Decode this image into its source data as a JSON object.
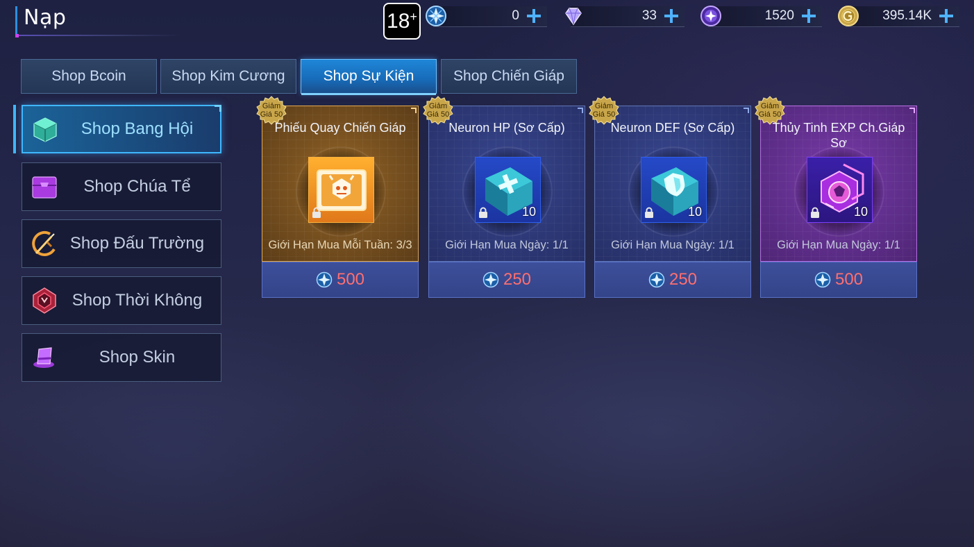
{
  "header": {
    "title": "Nạp",
    "age_rating": "18",
    "age_rating_suffix": "+"
  },
  "currencies": [
    {
      "icon": "bcoin-icon",
      "value": "0"
    },
    {
      "icon": "diamond-icon",
      "value": "33"
    },
    {
      "icon": "star-crystal-icon",
      "value": "1520"
    },
    {
      "icon": "gold-coin-icon",
      "value": "395.14K"
    }
  ],
  "tabs": [
    {
      "label": "Shop Bcoin",
      "active": false
    },
    {
      "label": "Shop Kim Cương",
      "active": false
    },
    {
      "label": "Shop Sự Kiện",
      "active": true
    },
    {
      "label": "Shop Chiến Giáp",
      "active": false
    }
  ],
  "sidebar": {
    "items": [
      {
        "label": "Shop Bang Hội",
        "icon": "guild-cube-icon",
        "active": true
      },
      {
        "label": "Shop Chúa Tể",
        "icon": "chest-icon",
        "active": false
      },
      {
        "label": "Shop Đấu Trường",
        "icon": "crossed-swords-icon",
        "active": false
      },
      {
        "label": "Shop Thời Không",
        "icon": "emblem-icon",
        "active": false
      },
      {
        "label": "Shop Skin",
        "icon": "hat-icon",
        "active": false
      }
    ]
  },
  "cards": [
    {
      "name": "Phiếu Quay Chiến Giáp",
      "badge_line1": "Giảm",
      "badge_line2": "Giá 50",
      "limit": "Giới Hạn Mua Mỗi Tuần: 3/3",
      "price": "500",
      "qty": "",
      "style": "gold",
      "item_icon": "mecha-ticket-icon"
    },
    {
      "name": "Neuron HP (Sơ Cấp)",
      "badge_line1": "Giảm",
      "badge_line2": "Giá 50",
      "limit": "Giới Hạn Mua Ngày: 1/1",
      "price": "250",
      "qty": "10",
      "style": "blue",
      "item_icon": "hp-book-icon"
    },
    {
      "name": "Neuron DEF (Sơ Cấp)",
      "badge_line1": "Giảm",
      "badge_line2": "Giá 50",
      "limit": "Giới Hạn Mua Ngày: 1/1",
      "price": "250",
      "qty": "10",
      "style": "blue",
      "item_icon": "def-book-icon"
    },
    {
      "name": "Thủy Tinh EXP Ch.Giáp Sơ",
      "badge_line1": "Giảm",
      "badge_line2": "Giá 50",
      "limit": "Giới Hạn Mua Ngày: 1/1",
      "price": "500",
      "qty": "10",
      "style": "purple",
      "item_icon": "exp-crystal-icon"
    }
  ],
  "colors": {
    "accent": "#3fb7ff",
    "price": "#ff6f6f",
    "gold_border": "#e0a54a",
    "purple_border": "#b56be0"
  }
}
